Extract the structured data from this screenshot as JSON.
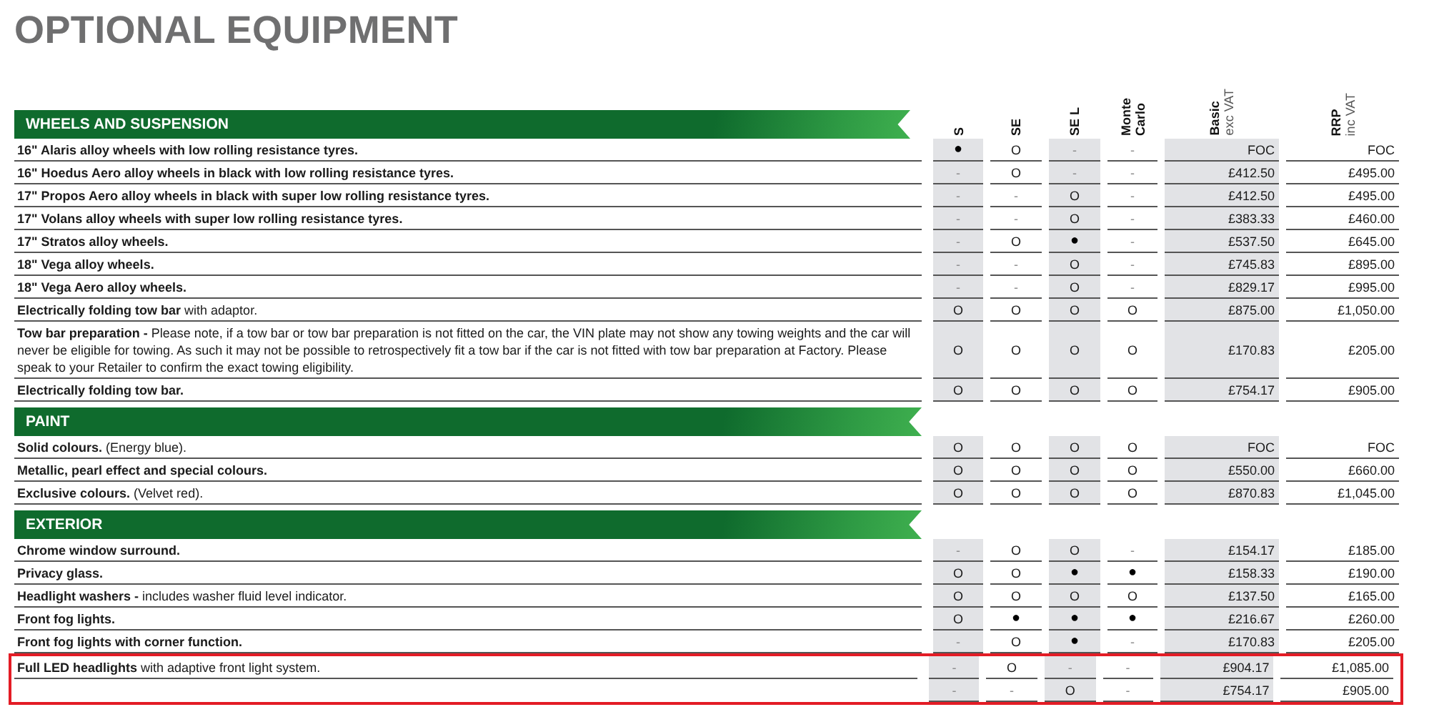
{
  "title": "OPTIONAL EQUIPMENT",
  "columns": [
    {
      "label": "S"
    },
    {
      "label": "SE"
    },
    {
      "label": "SE L"
    },
    {
      "label": "Monte Carlo"
    },
    {
      "label": "Basic",
      "note": "exc VAT"
    },
    {
      "label": "RRP",
      "note": "inc VAT"
    }
  ],
  "sections": [
    {
      "title": "WHEELS AND SUSPENSION",
      "rows": [
        {
          "feature": "16\" Alaris alloy wheels with low rolling resistance tyres.",
          "availability": [
            "●",
            "O",
            "-",
            "-"
          ],
          "basic": "FOC",
          "rrp": "FOC",
          "highlighted": false
        },
        {
          "feature": "16\" Hoedus Aero alloy wheels in black with low rolling resistance tyres.",
          "availability": [
            "-",
            "O",
            "-",
            "-"
          ],
          "basic": "£412.50",
          "rrp": "£495.00",
          "highlighted": false
        },
        {
          "feature": "17\" Propos Aero alloy wheels in black with super low rolling resistance tyres.",
          "availability": [
            "-",
            "-",
            "O",
            "-"
          ],
          "basic": "£412.50",
          "rrp": "£495.00",
          "highlighted": false
        },
        {
          "feature": "17\" Volans alloy wheels with super low rolling resistance tyres.",
          "availability": [
            "-",
            "-",
            "O",
            "-"
          ],
          "basic": "£383.33",
          "rrp": "£460.00",
          "highlighted": false
        },
        {
          "feature": "17\" Stratos alloy wheels.",
          "availability": [
            "-",
            "O",
            "●",
            "-"
          ],
          "basic": "£537.50",
          "rrp": "£645.00",
          "highlighted": false
        },
        {
          "feature": "18\" Vega alloy wheels.",
          "availability": [
            "-",
            "-",
            "O",
            "-"
          ],
          "basic": "£745.83",
          "rrp": "£895.00",
          "highlighted": false
        },
        {
          "feature": "18\" Vega Aero alloy wheels.",
          "availability": [
            "-",
            "-",
            "O",
            "-"
          ],
          "basic": "£829.17",
          "rrp": "£995.00",
          "highlighted": false
        },
        {
          "feature": "Electrically folding tow bar",
          "detail": "with adaptor.",
          "availability": [
            "O",
            "O",
            "O",
            "O"
          ],
          "basic": "£875.00",
          "rrp": "£1,050.00",
          "highlighted": false
        },
        {
          "feature": "Tow bar preparation -",
          "detail": "Please note, if a tow bar or tow bar preparation is not fitted on the car, the VIN plate may not show any towing weights and the car will never be eligible for towing. As such it may not be possible to retrospectively fit a tow bar if the car is not fitted with tow bar preparation at Factory. Please speak to your Retailer to confirm the exact towing eligibility.",
          "availability": [
            "O",
            "O",
            "O",
            "O"
          ],
          "basic": "£170.83",
          "rrp": "£205.00",
          "highlighted": false
        },
        {
          "feature": "Electrically folding tow bar.",
          "availability": [
            "O",
            "O",
            "O",
            "O"
          ],
          "basic": "£754.17",
          "rrp": "£905.00",
          "highlighted": false
        }
      ]
    },
    {
      "title": "PAINT",
      "rows": [
        {
          "feature": "Solid colours.",
          "detail": "(Energy blue).",
          "availability": [
            "O",
            "O",
            "O",
            "O"
          ],
          "basic": "FOC",
          "rrp": "FOC",
          "highlighted": false
        },
        {
          "feature": "Metallic, pearl effect and special colours.",
          "availability": [
            "O",
            "O",
            "O",
            "O"
          ],
          "basic": "£550.00",
          "rrp": "£660.00",
          "highlighted": false
        },
        {
          "feature": "Exclusive colours.",
          "detail": "(Velvet red).",
          "availability": [
            "O",
            "O",
            "O",
            "O"
          ],
          "basic": "£870.83",
          "rrp": "£1,045.00",
          "highlighted": false
        }
      ]
    },
    {
      "title": "EXTERIOR",
      "rows": [
        {
          "feature": "Chrome window surround.",
          "availability": [
            "-",
            "O",
            "O",
            "-"
          ],
          "basic": "£154.17",
          "rrp": "£185.00",
          "highlighted": false
        },
        {
          "feature": "Privacy glass.",
          "availability": [
            "O",
            "O",
            "●",
            "●"
          ],
          "basic": "£158.33",
          "rrp": "£190.00",
          "highlighted": false
        },
        {
          "feature": "Headlight washers -",
          "detail": "includes washer fluid level indicator.",
          "availability": [
            "O",
            "O",
            "O",
            "O"
          ],
          "basic": "£137.50",
          "rrp": "£165.00",
          "highlighted": false
        },
        {
          "feature": "Front fog lights.",
          "availability": [
            "O",
            "●",
            "●",
            "●"
          ],
          "basic": "£216.67",
          "rrp": "£260.00",
          "highlighted": false
        },
        {
          "feature": "Front fog lights with corner function.",
          "availability": [
            "-",
            "O",
            "●",
            "-"
          ],
          "basic": "£170.83",
          "rrp": "£205.00",
          "highlighted": false
        },
        {
          "feature": "Full LED headlights",
          "detail": "with adaptive front light system.",
          "availability": [
            "-",
            "O",
            "-",
            "-"
          ],
          "basic": "£904.17",
          "rrp": "£1,085.00",
          "highlighted": true
        },
        {
          "availability": [
            "-",
            "-",
            "O",
            "-"
          ],
          "basic": "£754.17",
          "rrp": "£905.00",
          "highlighted": true
        }
      ]
    }
  ]
}
